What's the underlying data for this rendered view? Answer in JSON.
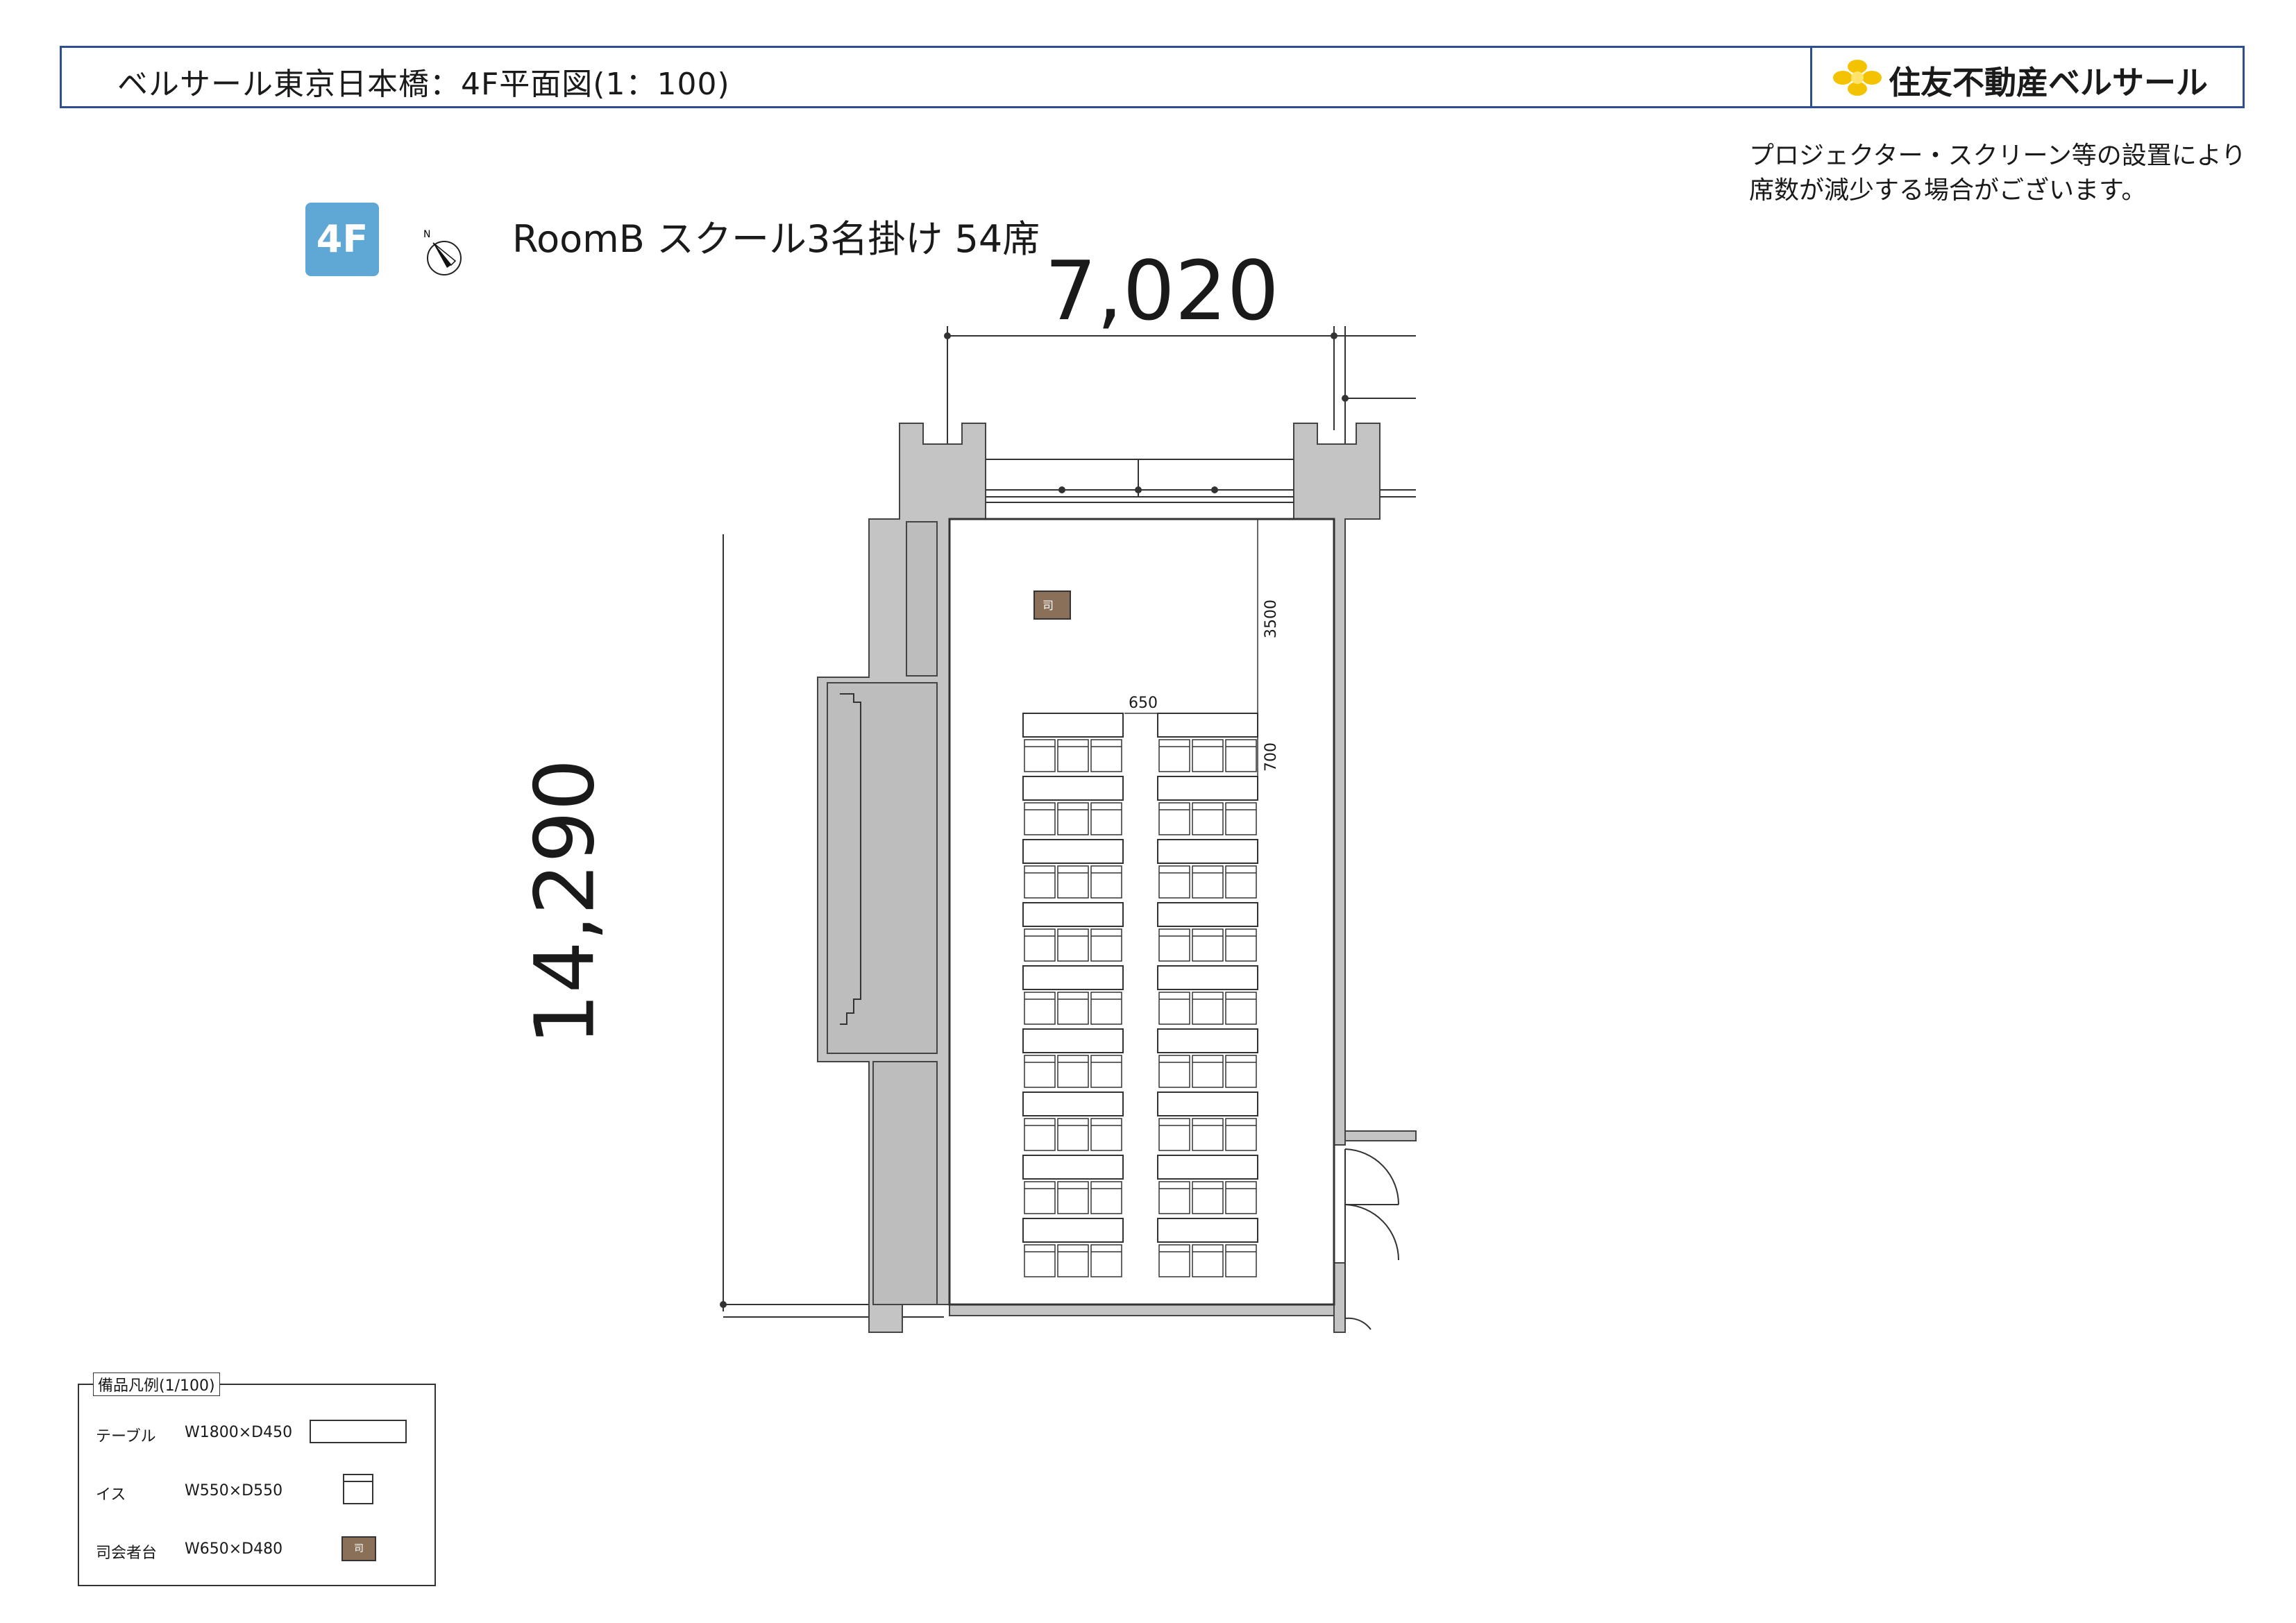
{
  "header": {
    "title": "ベルサール東京日本橋：4F平面図(1：100)",
    "logo": "住友不動産ベルサール"
  },
  "notice": [
    "プロジェクター・スクリーン等の設置により",
    "席数が減少する場合がございます。"
  ],
  "floor_badge": "4F",
  "compass_label": "N",
  "room_caption": "RoomB スクール3名掛け 54席",
  "dimensions": {
    "width": "7,020",
    "height": "14,290",
    "front_clearance": "3500",
    "aisle": "650",
    "row_pitch": "700"
  },
  "layout": {
    "rows_per_column": 9,
    "columns": 2,
    "seats_per_table": 3,
    "total_seats": 54
  },
  "podium_label": "司",
  "legend": {
    "title": "備品凡例(1/100)",
    "items": [
      {
        "name": "テーブル",
        "size": "W1800×D450"
      },
      {
        "name": "イス",
        "size": "W550×D550"
      },
      {
        "name": "司会者台",
        "size": "W650×D480",
        "symbol": "司"
      }
    ]
  },
  "colors": {
    "header_border": "#2e4f8f",
    "badge": "#5fa8d6",
    "wall": "#c4c4c4",
    "podium": "#8a7058",
    "logo_flower": "#f3c300"
  }
}
